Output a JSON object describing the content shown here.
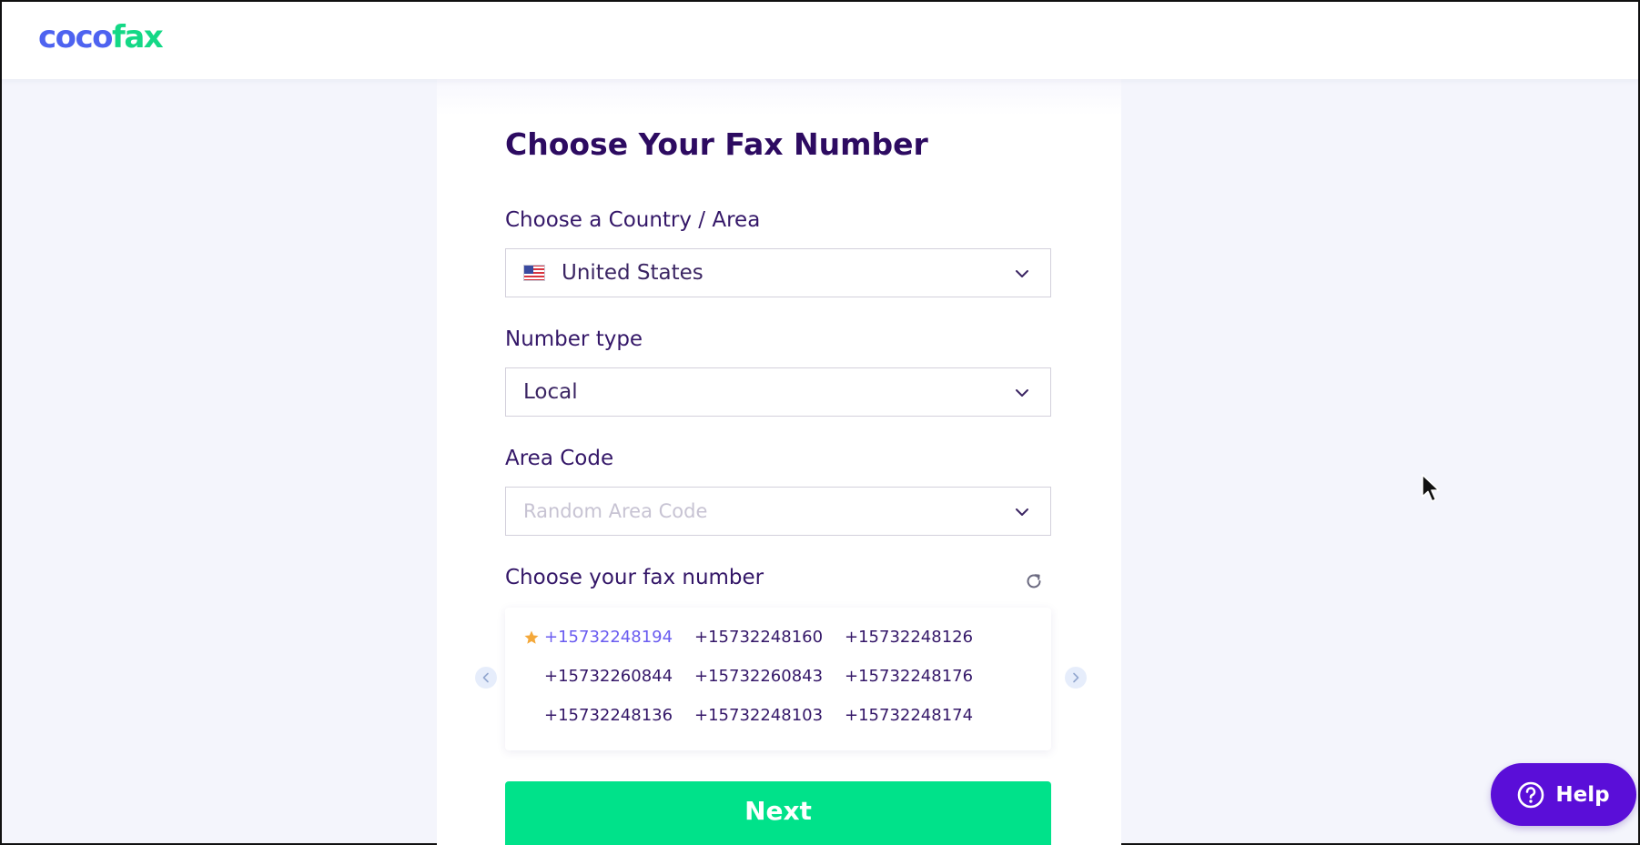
{
  "brand": {
    "logo_part1": "coco",
    "logo_part2": "fax",
    "color_primary": "#4e63f0",
    "color_accent": "#14d886"
  },
  "page": {
    "title": "Choose Your Fax Number"
  },
  "country": {
    "label": "Choose a Country / Area",
    "value": "United States",
    "flag_icon": "us-flag-icon"
  },
  "number_type": {
    "label": "Number type",
    "value": "Local"
  },
  "area_code": {
    "label": "Area Code",
    "placeholder": "Random Area Code"
  },
  "fax_numbers": {
    "label": "Choose your fax number",
    "refresh_icon": "refresh-icon",
    "selected_index": 0,
    "items": [
      "+15732248194",
      "+15732248160",
      "+15732248126",
      "+15732260844",
      "+15732260843",
      "+15732248176",
      "+15732248136",
      "+15732248103",
      "+15732248174"
    ]
  },
  "actions": {
    "next_label": "Next",
    "next_color": "#00e28a"
  },
  "help": {
    "label": "Help",
    "color": "#5a0ed8"
  }
}
